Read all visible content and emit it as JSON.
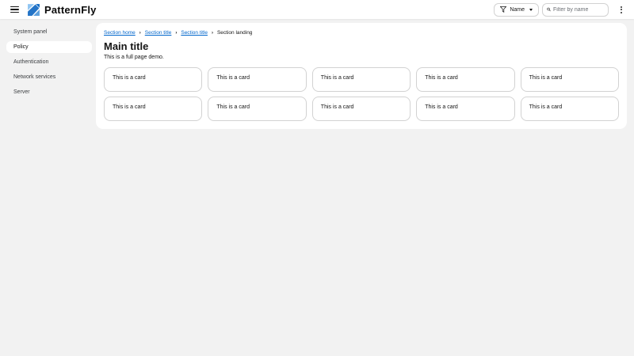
{
  "header": {
    "brand": "PatternFly",
    "filter": {
      "label": "Name"
    },
    "search": {
      "placeholder": "Filter by name"
    }
  },
  "sidebar": {
    "items": [
      {
        "label": "System panel",
        "selected": false
      },
      {
        "label": "Policy",
        "selected": true
      },
      {
        "label": "Authentication",
        "selected": false
      },
      {
        "label": "Network services",
        "selected": false
      },
      {
        "label": "Server",
        "selected": false
      }
    ]
  },
  "main": {
    "breadcrumb": [
      {
        "label": "Section home",
        "link": true
      },
      {
        "label": "Section title",
        "link": true
      },
      {
        "label": "Section title",
        "link": true
      },
      {
        "label": "Section landing",
        "link": false
      }
    ],
    "title": "Main title",
    "subtitle": "This is a full page demo.",
    "cards": [
      "This is a card",
      "This is a card",
      "This is a card",
      "This is a card",
      "This is a card",
      "This is a card",
      "This is a card",
      "This is a card",
      "This is a card",
      "This is a card"
    ]
  },
  "icons": {
    "breadcrumb_separator": "›"
  },
  "colors": {
    "link_blue": "#0066cc",
    "logo_light_blue": "#8fc4f2",
    "logo_dark_blue": "#0a66c2",
    "page_background": "#f2f2f2",
    "panel_background": "#ffffff",
    "border": "#d2d2d2",
    "text": "#151515"
  }
}
